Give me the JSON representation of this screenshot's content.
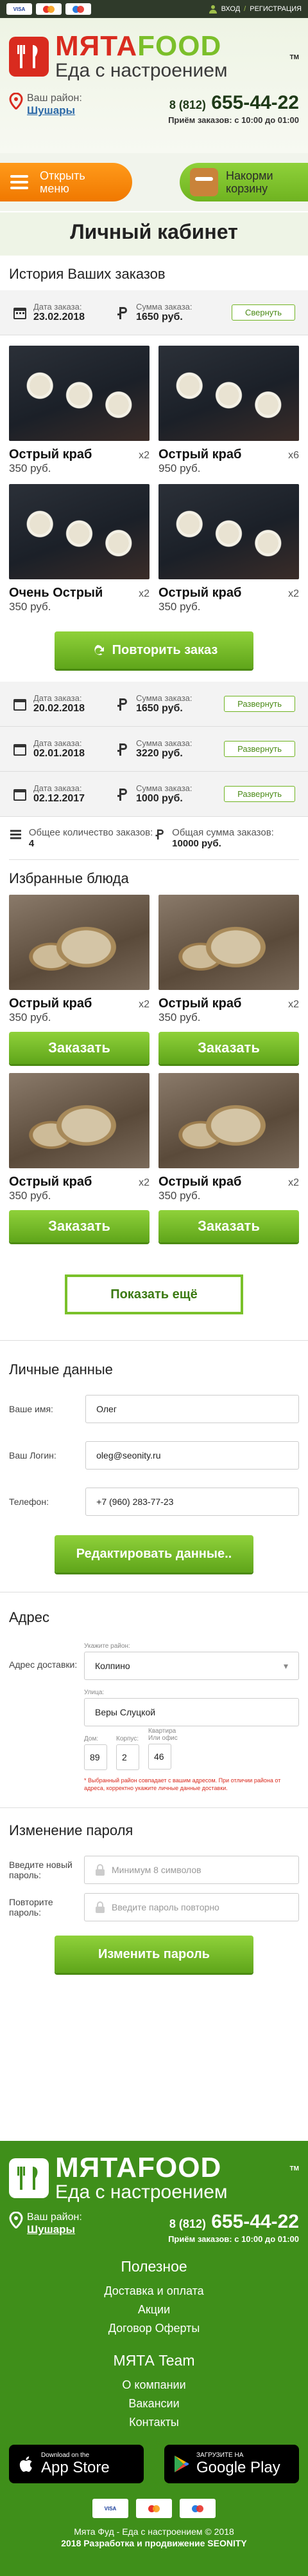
{
  "topbar": {
    "cards": [
      "VISA",
      "MasterCard",
      "Maestro"
    ],
    "login": "ВХОД",
    "separator": "/",
    "register": "РЕГИСТРАЦИЯ"
  },
  "brand": {
    "name_a": "МЯТА",
    "name_b": "FOOD",
    "tm": "TM",
    "slogan": "Еда с настроением"
  },
  "region": {
    "label": "Ваш район:",
    "value": "Шушары"
  },
  "phone": {
    "prefix": "8 (812)",
    "number": "655-44-22",
    "hours": "Приём заказов: с 10:00 до 01:00"
  },
  "menu": {
    "open_label": "Открыть меню",
    "cart_label": "Накорми корзину"
  },
  "page_title": "Личный кабинет",
  "history": {
    "title": "История Ваших заказов",
    "date_label": "Дата заказа:",
    "sum_label": "Сумма заказа:",
    "collapse": "Свернуть",
    "expand": "Развернуть",
    "first_order": {
      "date": "23.02.2018",
      "sum": "1650 руб.",
      "items": [
        {
          "name": "Острый краб",
          "qty": "x2",
          "price": "350 руб."
        },
        {
          "name": "Острый краб",
          "qty": "x6",
          "price": "950 руб."
        },
        {
          "name": "Очень Острый",
          "qty": "x2",
          "price": "350 руб."
        },
        {
          "name": "Острый краб",
          "qty": "x2",
          "price": "350 руб."
        }
      ]
    },
    "repeat": "Повторить заказ",
    "orders": [
      {
        "date": "20.02.2018",
        "sum": "1650 руб."
      },
      {
        "date": "02.01.2018",
        "sum": "3220 руб."
      },
      {
        "date": "02.12.2017",
        "sum": "1000 руб."
      }
    ],
    "total_count_label": "Общее количество заказов:",
    "total_count": "4",
    "total_sum_label": "Общая сумма заказов:",
    "total_sum": "10000 руб."
  },
  "favorites": {
    "title": "Избранные блюда",
    "order_label": "Заказать",
    "items": [
      {
        "name": "Острый краб",
        "qty": "x2",
        "price": "350 руб."
      },
      {
        "name": "Острый краб",
        "qty": "x2",
        "price": "350 руб."
      },
      {
        "name": "Острый краб",
        "qty": "x2",
        "price": "350 руб."
      },
      {
        "name": "Острый краб",
        "qty": "x2",
        "price": "350 руб."
      }
    ],
    "show_more": "Показать ещё"
  },
  "personal": {
    "title": "Личные данные",
    "name_label": "Ваше имя:",
    "name": "Олег",
    "login_label": "Ваш Логин:",
    "login": "oleg@seonity.ru",
    "phone_label": "Телефон:",
    "phone": "+7 (960) 283-77-23",
    "edit": "Редактировать данные.."
  },
  "address": {
    "title": "Адрес",
    "label": "Адрес доставки:",
    "district_hint": "Укажите район:",
    "district": "Колпино",
    "street_hint": "Улица:",
    "street": "Веры Слуцкой",
    "house_hint": "Дом:",
    "house": "89",
    "korpus_hint": "Корпус:",
    "korpus": "2",
    "flat_hint": "Квартира\nИли офис",
    "flat": "46",
    "note": "* Выбранный район совпадает с вашим адресом. При отличии района от адреса, корректно укажите личные данные доставки."
  },
  "password": {
    "title": "Изменение пароля",
    "new_label": "Введите новый пароль:",
    "new_placeholder": "Минимум 8 символов",
    "repeat_label": "Повторите пароль:",
    "repeat_placeholder": "Введите пароль повторно",
    "change": "Изменить пароль"
  },
  "footer": {
    "useful_title": "Полезное",
    "useful_links": [
      "Доставка и оплата",
      "Акции",
      "Договор Оферты"
    ],
    "team_title": "МЯТА Team",
    "team_links": [
      "О компании",
      "Вакансии",
      "Контакты"
    ],
    "appstore_small": "Download on the",
    "appstore_big": "App Store",
    "gplay_small": "ЗАГРУЗИТЕ НА",
    "gplay_big": "Google Play",
    "copyright": "Мята Фуд - Еда с настроением © 2018",
    "dev": "2018 Разработка и продвижение SEONITY"
  },
  "colors": {
    "green": "#6fb320",
    "orange": "#f07800",
    "red": "#d92b1f",
    "footer": "#3f8f1a"
  }
}
